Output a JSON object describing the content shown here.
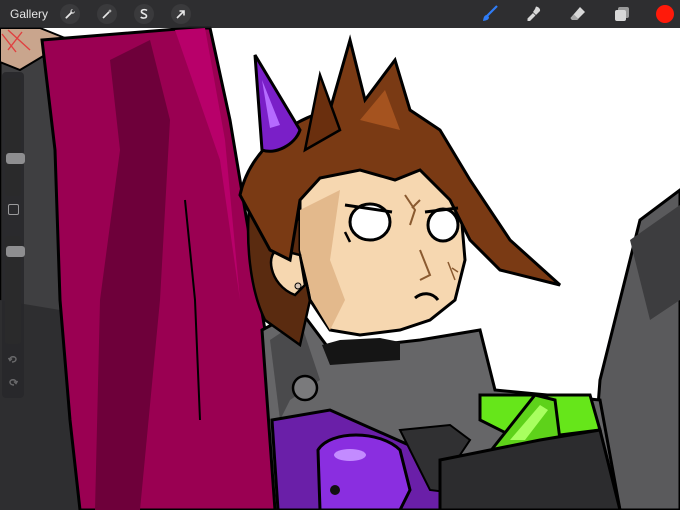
{
  "toolbar": {
    "gallery_label": "Gallery",
    "left_tools": [
      {
        "name": "actions",
        "icon": "wrench-icon"
      },
      {
        "name": "adjustments",
        "icon": "magic-wand-icon"
      },
      {
        "name": "selection",
        "icon": "selection-s-icon"
      },
      {
        "name": "transform",
        "icon": "arrow-cursor-icon"
      }
    ],
    "right_tools": [
      {
        "name": "brush",
        "icon": "brush-icon",
        "active": true
      },
      {
        "name": "smudge",
        "icon": "smudge-icon"
      },
      {
        "name": "eraser",
        "icon": "eraser-icon"
      },
      {
        "name": "layers",
        "icon": "layers-icon"
      }
    ],
    "current_color": "#ff1a0a",
    "active_tool_color": "#2f7cf6"
  },
  "sidebar": {
    "brush_size_level": 0.3,
    "opacity_level": 0.9,
    "modify_icon": "square-icon",
    "undo_icon": "undo-arrow-icon",
    "redo_icon": "redo-arrow-icon"
  }
}
